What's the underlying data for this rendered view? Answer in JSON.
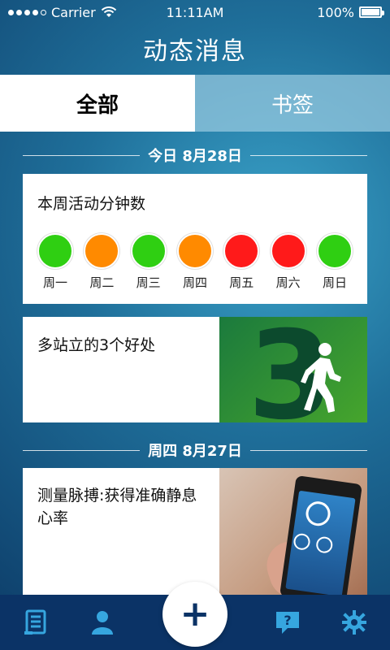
{
  "status_bar": {
    "carrier": "Carrier",
    "time": "11:11AM",
    "battery": "100%"
  },
  "header": {
    "title": "动态消息"
  },
  "tabs": [
    {
      "label": "全部",
      "active": true
    },
    {
      "label": "书签",
      "active": false
    }
  ],
  "sections": [
    {
      "date_label": "今日 8月28日"
    },
    {
      "date_label": "周四 8月27日"
    }
  ],
  "activity_card": {
    "title": "本周活动分钟数",
    "days": [
      {
        "label": "周一",
        "color": "#2fcf12"
      },
      {
        "label": "周二",
        "color": "#ff8a00"
      },
      {
        "label": "周三",
        "color": "#2fcf12"
      },
      {
        "label": "周四",
        "color": "#ff8a00"
      },
      {
        "label": "周五",
        "color": "#ff1a1a"
      },
      {
        "label": "周六",
        "color": "#ff1a1a"
      },
      {
        "label": "周日",
        "color": "#2fcf12"
      }
    ]
  },
  "tip_card": {
    "title": "多站立的3个好处",
    "image_glyph": "3"
  },
  "pulse_card": {
    "title": "测量脉搏:获得准确静息心率"
  },
  "bottom_nav": {
    "items": [
      {
        "icon": "journal-icon"
      },
      {
        "icon": "profile-icon"
      },
      {
        "icon": "help-icon"
      },
      {
        "icon": "gear-icon"
      }
    ],
    "fab_label": "+"
  },
  "colors": {
    "nav_background": "#0b3366",
    "tab_inactive": "#a5d2e6"
  }
}
